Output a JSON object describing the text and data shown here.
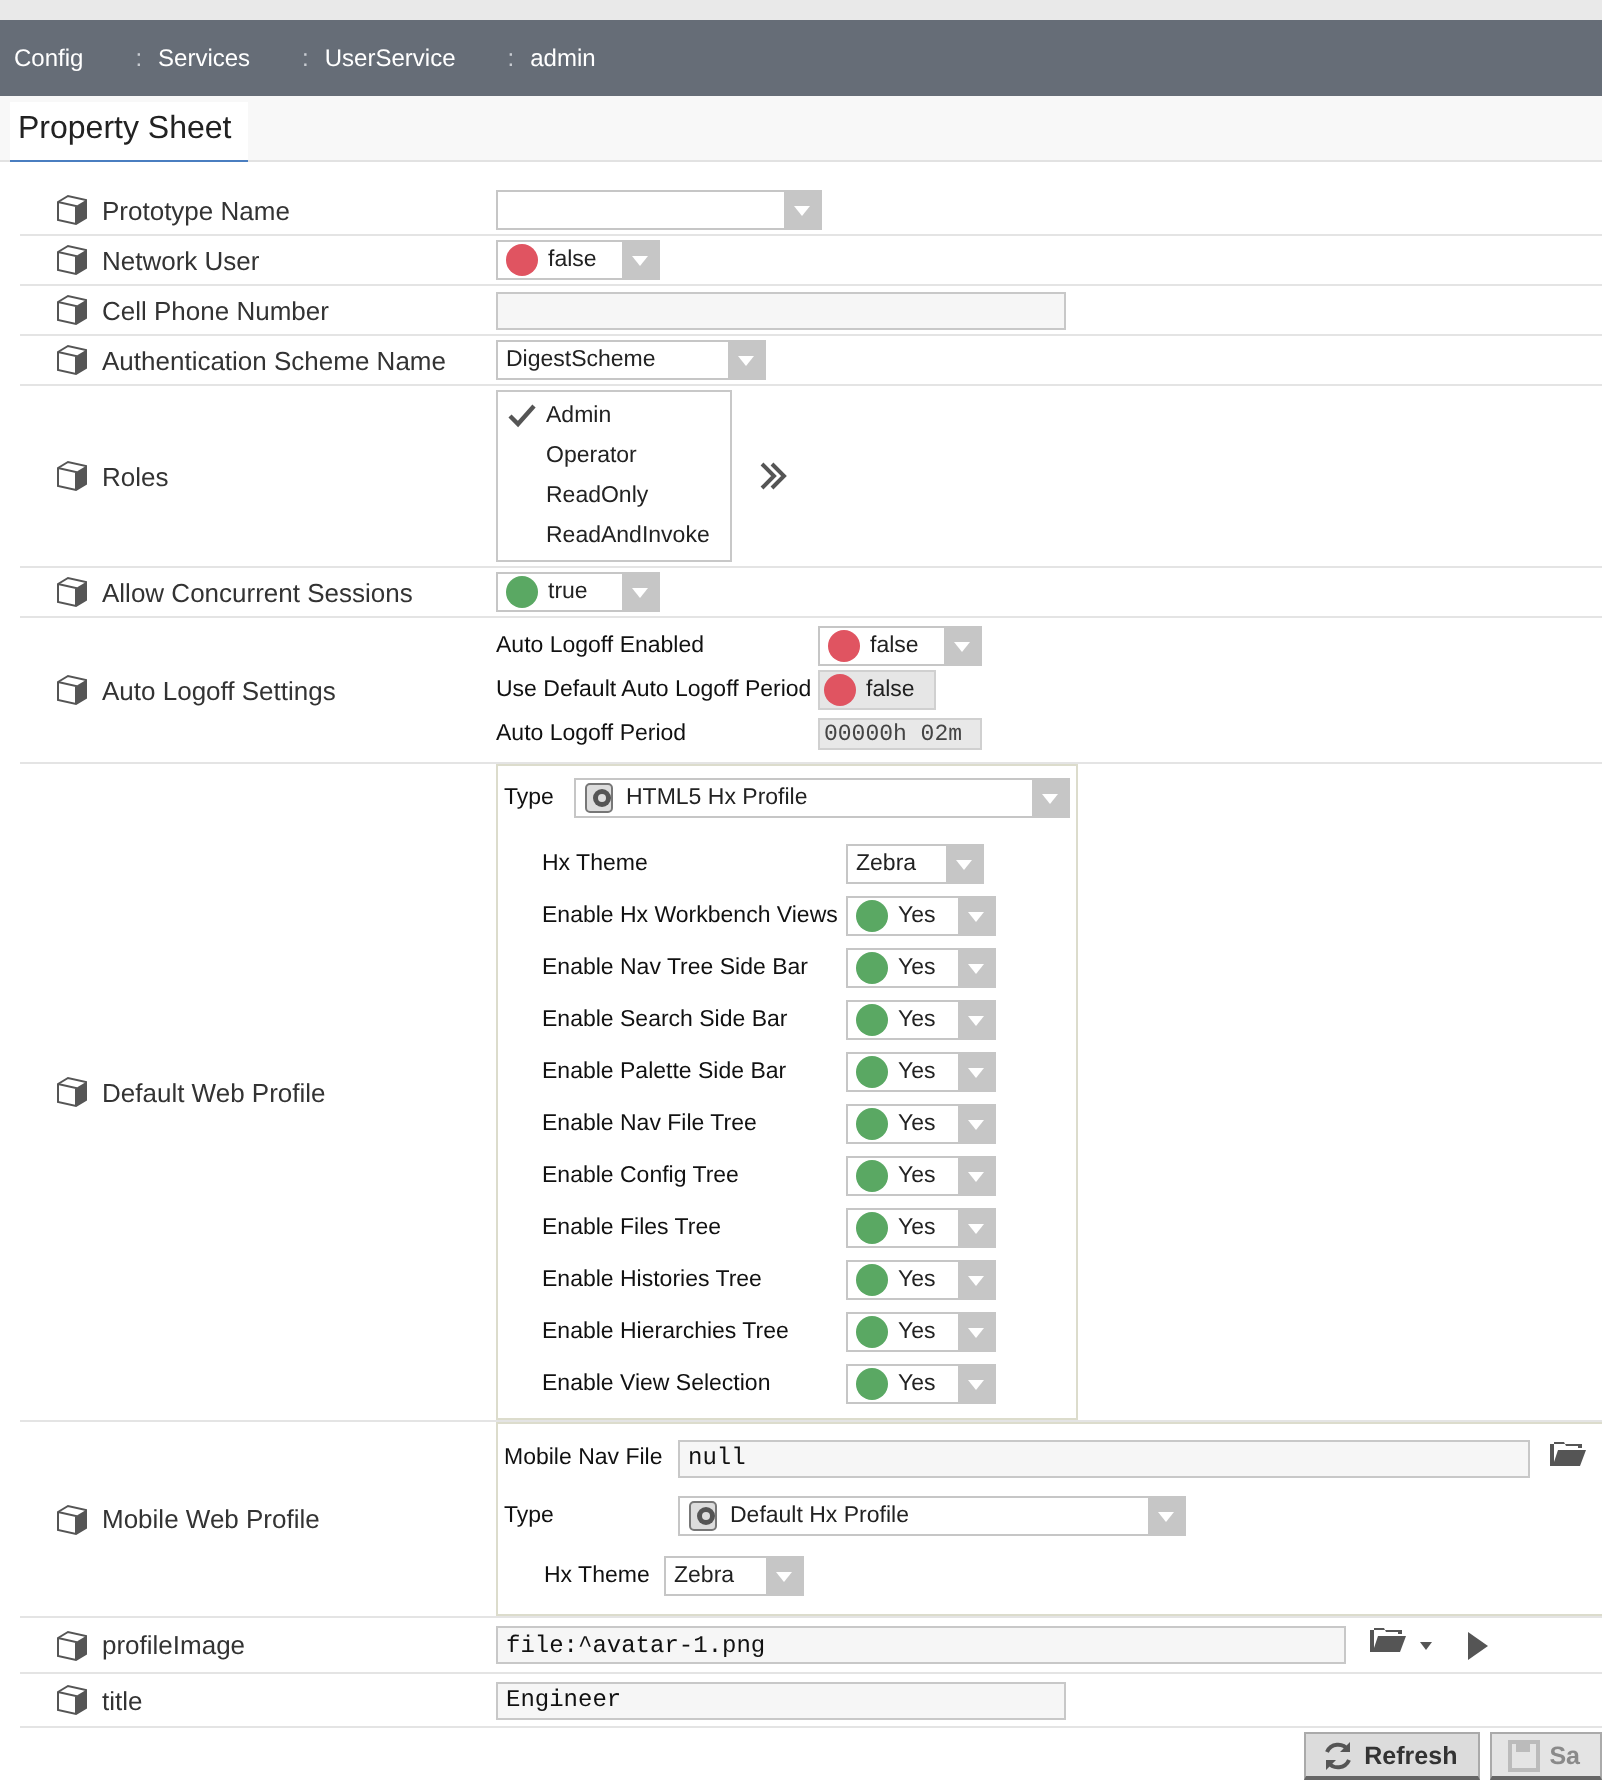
{
  "breadcrumb": [
    "Config",
    "Services",
    "UserService",
    "admin"
  ],
  "breadcrumb_separator": ":",
  "tab": {
    "label": "Property Sheet",
    "selected": true
  },
  "properties": [
    {
      "kind": "dropdown",
      "label": "Prototype Name"
    },
    {
      "kind": "bool",
      "label": "Network User",
      "value": "false",
      "on": false
    },
    {
      "kind": "text",
      "label": "Cell Phone Number"
    },
    {
      "kind": "dropdown",
      "label": "Authentication Scheme Name",
      "value": "DigestScheme"
    },
    {
      "kind": "roles",
      "label": "Roles",
      "options": [
        {
          "label": "Admin",
          "checked": true
        },
        {
          "label": "Operator",
          "checked": false
        },
        {
          "label": "ReadOnly",
          "checked": false
        },
        {
          "label": "ReadAndInvoke",
          "checked": false
        }
      ]
    },
    {
      "kind": "bool",
      "label": "Allow Concurrent Sessions",
      "value": "true",
      "on": true
    },
    {
      "kind": "group",
      "label": "Auto Logoff Settings",
      "fields": [
        {
          "kind": "bool",
          "label": "Auto Logoff Enabled",
          "value": "false",
          "on": false
        },
        {
          "kind": "readonly_bool",
          "label": "Use Default Auto Logoff Period",
          "value": "false",
          "on": false
        },
        {
          "kind": "duration",
          "label": "Auto Logoff Period",
          "value": "00000h 02m"
        }
      ]
    },
    {
      "kind": "profile",
      "label": "Default Web Profile",
      "fields": [
        {
          "kind": "type",
          "label": "Type",
          "value": "HTML5 Hx Profile"
        },
        {
          "kind": "dropdown",
          "label": "Hx Theme",
          "value": "Zebra"
        },
        {
          "kind": "bool",
          "label": "Enable Hx Workbench Views",
          "value": "Yes",
          "on": true
        },
        {
          "kind": "bool",
          "label": "Enable Nav Tree Side Bar",
          "value": "Yes",
          "on": true
        },
        {
          "kind": "bool",
          "label": "Enable Search Side Bar",
          "value": "Yes",
          "on": true
        },
        {
          "kind": "bool",
          "label": "Enable Palette Side Bar",
          "value": "Yes",
          "on": true
        },
        {
          "kind": "bool",
          "label": "Enable Nav File Tree",
          "value": "Yes",
          "on": true
        },
        {
          "kind": "bool",
          "label": "Enable Config Tree",
          "value": "Yes",
          "on": true
        },
        {
          "kind": "bool",
          "label": "Enable Files Tree",
          "value": "Yes",
          "on": true
        },
        {
          "kind": "bool",
          "label": "Enable Histories Tree",
          "value": "Yes",
          "on": true
        },
        {
          "kind": "bool",
          "label": "Enable Hierarchies Tree",
          "value": "Yes",
          "on": true
        },
        {
          "kind": "bool",
          "label": "Enable View Selection",
          "value": "Yes",
          "on": true
        }
      ]
    },
    {
      "kind": "mobile",
      "label": "Mobile Web Profile",
      "fields": [
        {
          "kind": "file",
          "label": "Mobile Nav File",
          "value": "null"
        },
        {
          "kind": "type",
          "label": "Type",
          "value": "Default Hx Profile"
        },
        {
          "kind": "dropdown",
          "label": "Hx Theme",
          "value": "Zebra"
        }
      ]
    },
    {
      "kind": "file",
      "label": "profileImage",
      "value": "file:^avatar-1.png"
    },
    {
      "kind": "text",
      "label": "title",
      "value": "Engineer"
    }
  ],
  "buttons": [
    {
      "label": "Refresh",
      "disabled": false
    },
    {
      "label": "Sa",
      "disabled": true
    }
  ]
}
